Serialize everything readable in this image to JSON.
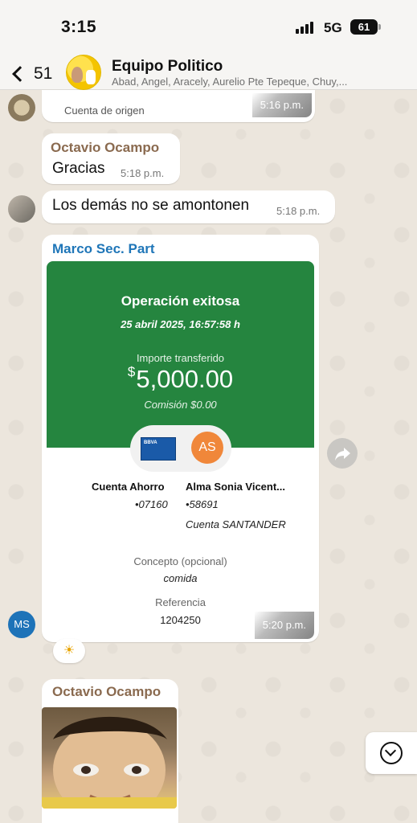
{
  "status_bar": {
    "time": "3:15",
    "network": "5G",
    "battery": "61"
  },
  "header": {
    "back_count": "51",
    "group_name": "Equipo Politico",
    "members": "Abad, Angel, Aracely, Aurelio Pte Tepeque, Chuy,..."
  },
  "messages": [
    {
      "type": "image_caption",
      "caption": "Cuenta de origen",
      "time": "5:16 p.m."
    },
    {
      "sender": "Octavio Ocampo",
      "text": "Gracias",
      "time": "5:18 p.m."
    },
    {
      "text": "Los demás no se amontonen",
      "time": "5:18 p.m."
    }
  ],
  "transfer_message": {
    "sender": "Marco Sec. Part",
    "receipt": {
      "title": "Operación exitosa",
      "date": "25 abril 2025, 16:57:58 h",
      "amount_label": "Importe transferido",
      "currency": "$",
      "amount": "5,000.00",
      "commission": "Comisión  $0.00",
      "bank_logo": "BBVA",
      "recipient_initials": "AS",
      "origin_account_name": "Cuenta Ahorro",
      "origin_account_number": "•07160",
      "dest_account_name": "Alma Sonia Vicent...",
      "dest_account_number": "•58691",
      "dest_bank": "Cuenta SANTANDER",
      "concept_label": "Concepto (opcional)",
      "concept_value": "comida",
      "reference_label": "Referencia",
      "reference_value": "1204250"
    },
    "time": "5:20 p.m.",
    "avatar_initials": "MS",
    "reaction": "☀"
  },
  "last_message": {
    "sender": "Octavio Ocampo"
  },
  "colors": {
    "sender_brown": "#8a6a4f",
    "sender_blue": "#1f76b8",
    "receipt_green": "#25853f"
  }
}
